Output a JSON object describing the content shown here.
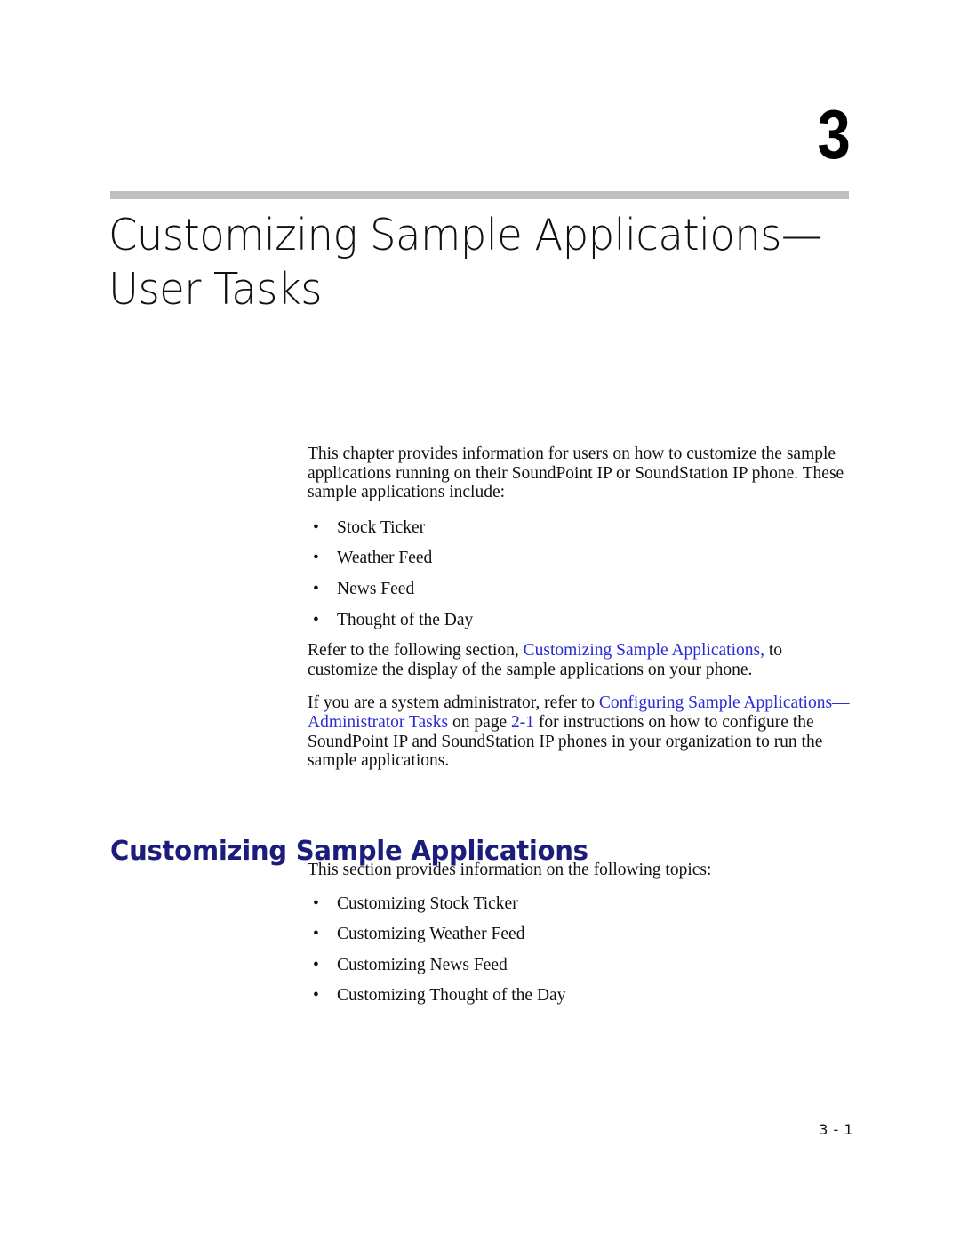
{
  "chapter": {
    "number": "3",
    "title_line1": "Customizing Sample Applications—",
    "title_line2": "User Tasks"
  },
  "intro": {
    "paragraph": "This chapter provides information for users on how to customize the sample applications running on their SoundPoint IP or SoundStation IP phone. These sample applications include:",
    "app_list": [
      "Stock Ticker",
      "Weather Feed",
      "News Feed",
      "Thought of the Day"
    ],
    "refer_paragraph": {
      "before": "Refer to the following section, ",
      "link": "Customizing Sample Applications,",
      "after": " to customize the display of the sample applications on your phone."
    },
    "admin_paragraph": {
      "before": "If you are a system administrator, refer to ",
      "link1": "Configuring Sample Applications—Administrator Tasks",
      "middle": " on page ",
      "link2": "2-1",
      "after": " for instructions on how to configure the SoundPoint IP and SoundStation IP phones in your organization to run the sample applications."
    }
  },
  "section": {
    "heading": "Customizing Sample Applications",
    "lead": "This section provides information on the following topics:",
    "topics": [
      "Customizing Stock Ticker",
      "Customizing Weather Feed",
      "Customizing News Feed",
      "Customizing Thought of the Day"
    ]
  },
  "footer": {
    "page_number": "3 - 1"
  },
  "bullet_glyph": "•",
  "colors": {
    "link_blue": "#2a2ad6",
    "heading_navy": "#1c1c7d",
    "rule_gray": "#bfbfbf",
    "text_black": "#111111"
  }
}
